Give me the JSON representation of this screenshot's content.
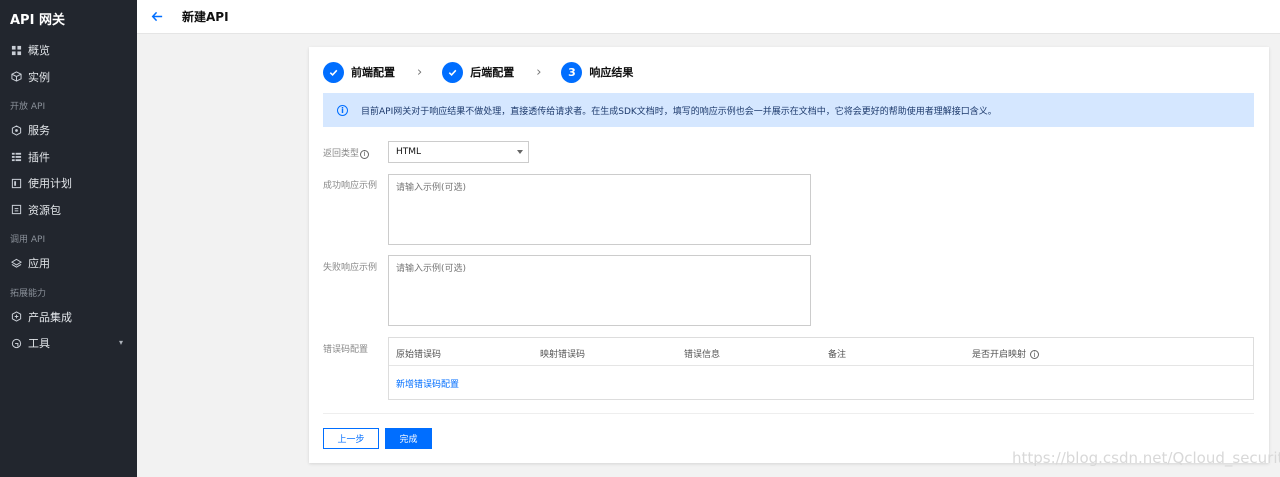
{
  "sidebar": {
    "brand": "API 网关",
    "items_top": [
      {
        "label": "概览",
        "icon": "grid-icon"
      },
      {
        "label": "实例",
        "icon": "cube-icon"
      }
    ],
    "group_open": "开放 API",
    "items_open": [
      {
        "label": "服务",
        "icon": "hexagon-icon"
      },
      {
        "label": "插件",
        "icon": "plugin-icon"
      },
      {
        "label": "使用计划",
        "icon": "plan-icon"
      },
      {
        "label": "资源包",
        "icon": "package-icon"
      }
    ],
    "group_call": "调用 API",
    "items_call": [
      {
        "label": "应用",
        "icon": "layers-icon"
      }
    ],
    "group_ext": "拓展能力",
    "items_ext": [
      {
        "label": "产品集成",
        "icon": "integration-icon"
      },
      {
        "label": "工具",
        "icon": "tools-icon"
      }
    ]
  },
  "header": {
    "title": "新建API"
  },
  "steps": [
    {
      "label": "前端配置",
      "state": "done"
    },
    {
      "label": "后端配置",
      "state": "done"
    },
    {
      "number": "3",
      "label": "响应结果",
      "state": "current"
    }
  ],
  "notice": "目前API网关对于响应结果不做处理，直接透传给请求者。在生成SDK文档时，填写的响应示例也会一并展示在文档中，它将会更好的帮助使用者理解接口含义。",
  "form": {
    "return_type_label": "返回类型",
    "return_type_value": "HTML",
    "success_label": "成功响应示例",
    "success_placeholder": "请输入示例(可选)",
    "failure_label": "失败响应示例",
    "failure_placeholder": "请输入示例(可选)",
    "error_label": "错误码配置",
    "error_columns": [
      "原始错误码",
      "映射错误码",
      "错误信息",
      "备注",
      "是否开启映射"
    ],
    "add_error_link": "新增错误码配置"
  },
  "buttons": {
    "prev": "上一步",
    "done": "完成"
  },
  "watermark": "https://blog.csdn.net/Qcloud_security",
  "colors": {
    "accent": "#006eff",
    "sidebar_bg": "#22262e",
    "notice_bg": "#d5e7ff"
  }
}
